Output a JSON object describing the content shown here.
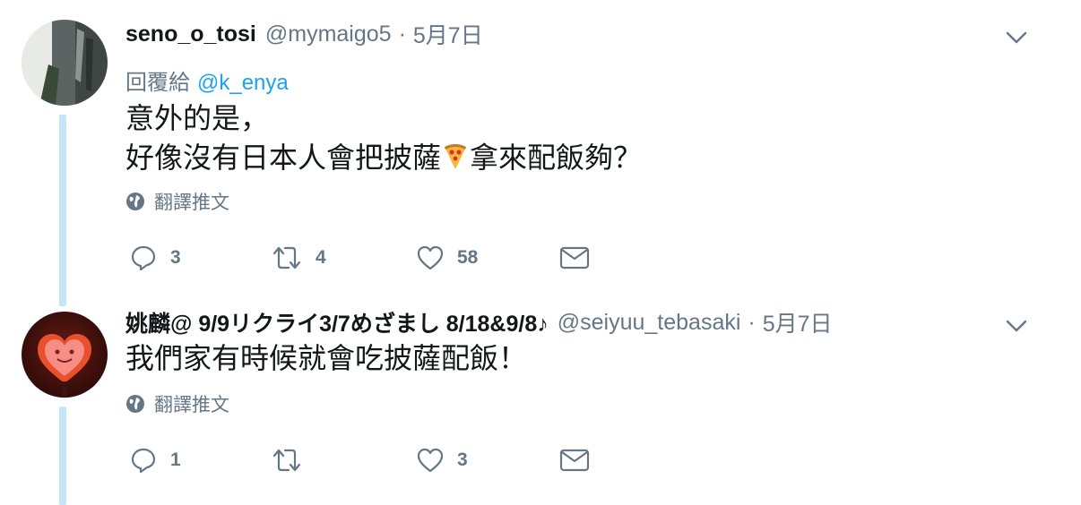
{
  "tweets": [
    {
      "name": "seno_o_tosi",
      "handle": "@mymaigo5",
      "separator": "·",
      "date": "5月7日",
      "replying_label": "回覆給",
      "replying_mention": "@k_enya",
      "text_line1": "意外的是，",
      "text_line2_part1": "好像沒有日本人會把披薩",
      "text_emoji": "🍕",
      "text_line2_part2": "拿來配飯夠？",
      "translate_label": "翻譯推文",
      "reply_count": "3",
      "retweet_count": "4",
      "like_count": "58"
    },
    {
      "name": "姚麟@ 9/9リクライ3/7めざまし 8/18&9/8♪",
      "handle": "@seiyuu_tebasaki",
      "separator": "·",
      "date": "5月7日",
      "text": "我們家有時候就會吃披薩配飯！",
      "translate_label": "翻譯推文",
      "reply_count": "1",
      "retweet_count": "",
      "like_count": "3"
    }
  ],
  "colors": {
    "secondary": "#657786",
    "link": "#1da1f2",
    "thread_line": "#c4e6f7",
    "text": "#14171a"
  },
  "icons": [
    "caret-down-icon",
    "globe-icon",
    "reply-icon",
    "retweet-icon",
    "like-icon",
    "envelope-icon",
    "pizza-emoji"
  ]
}
